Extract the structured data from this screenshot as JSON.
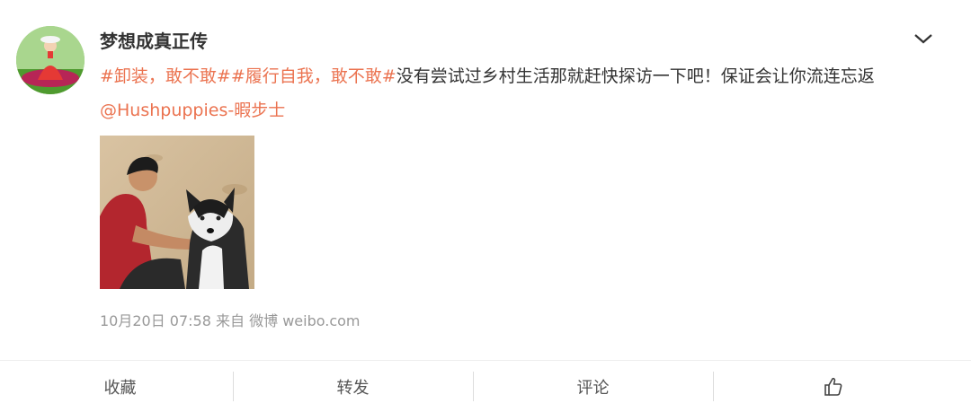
{
  "post": {
    "username": "梦想成真正传",
    "text": {
      "tag1": "#卸装，敢不敢#",
      "tag2": "#履行自我，敢不敢#",
      "body": "没有尝试过乡村生活那就赶快探访一下吧！保证会让你流连忘返",
      "mention": "@Hushpuppies-暇步士"
    },
    "meta": {
      "date": "10月20日 07:58",
      "from_label": "来自",
      "source": "微博 weibo.com"
    }
  },
  "actions": {
    "favorite": "收藏",
    "repost": "转发",
    "comment": "评论"
  },
  "icons": {
    "menu": "chevron-down-icon",
    "like": "thumbs-up-icon"
  },
  "colors": {
    "link": "#eb7350",
    "text": "#333333",
    "meta": "#999999"
  }
}
